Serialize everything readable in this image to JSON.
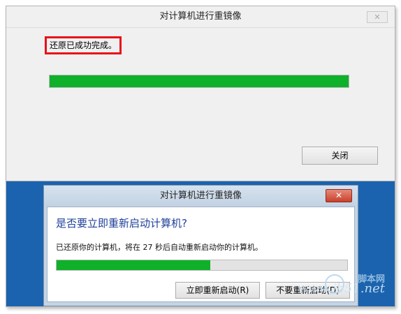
{
  "top_window": {
    "title": "对计算机进行重镜像",
    "close_icon": "close-icon",
    "restore_message": "还原已成功完成。",
    "progress_percent": 100,
    "close_button_label": "关闭"
  },
  "restart_dialog": {
    "title": "对计算机进行重镜像",
    "close_icon": "close-icon",
    "question": "是否要立即重新启动计算机?",
    "countdown_message": "已还原你的计算机，将在 27 秒后自动重新启动你的计算机。",
    "progress_percent": 53,
    "restart_now_label": "立即重新启动(R)",
    "dont_restart_label": "不要重新启动(D)"
  },
  "watermark": {
    "site_name": "脚本网",
    "url": "www.jb51.net"
  },
  "colors": {
    "progress_green": "#0fb02a",
    "highlight_red": "#e8101a",
    "desktop_blue": "#1b63ae",
    "question_blue": "#1e3f9a"
  }
}
